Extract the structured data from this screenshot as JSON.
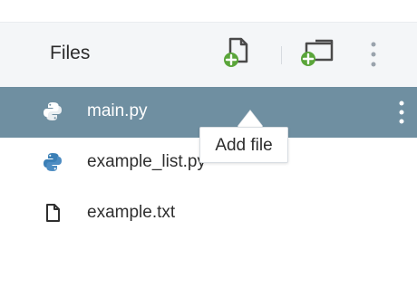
{
  "header": {
    "title": "Files",
    "add_file_icon": "add-file-icon",
    "add_folder_icon": "add-folder-icon",
    "more_icon": "kebab-icon"
  },
  "files": [
    {
      "name": "main.py",
      "icon": "python-icon",
      "selected": true
    },
    {
      "name": "example_list.py",
      "icon": "python-icon",
      "selected": false
    },
    {
      "name": "example.txt",
      "icon": "text-file-icon",
      "selected": false
    }
  ],
  "tooltip": {
    "text": "Add file"
  },
  "colors": {
    "header_bg": "#f4f6f8",
    "selected_row": "#6f8fa1",
    "icon_green": "#5aa53a",
    "python_blue": "#3b7fb6",
    "python_yellow": "#f2c94c"
  }
}
